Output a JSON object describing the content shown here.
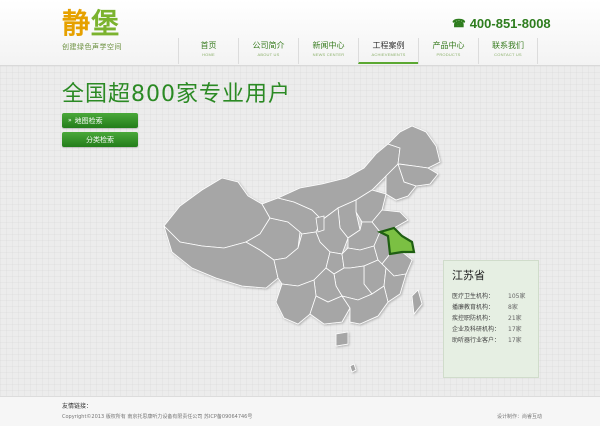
{
  "header": {
    "logo_title": "静堡",
    "logo_subtitle": "创建绿色声学空间",
    "phone": "400-851-8008"
  },
  "nav": [
    {
      "cn": "首页",
      "en": "HOME",
      "active": false
    },
    {
      "cn": "公司简介",
      "en": "ABOUT US",
      "active": false
    },
    {
      "cn": "新闻中心",
      "en": "NEWS CENTER",
      "active": false
    },
    {
      "cn": "工程案例",
      "en": "ACHIEVEMENTS",
      "active": true
    },
    {
      "cn": "产品中心",
      "en": "PRODUCTS",
      "active": false
    },
    {
      "cn": "联系我们",
      "en": "CONTACT US",
      "active": false
    }
  ],
  "main": {
    "headline": "全国超800家专业用户",
    "map_search_label": "地图检索",
    "category_search_label": "分类检索"
  },
  "map": {
    "highlighted_region": "江苏省",
    "highlight_color": "#7bc043",
    "base_color": "#a6a6a6"
  },
  "info": {
    "province": "江苏省",
    "rows": [
      {
        "label": "医疗卫生机构：",
        "value": "105家"
      },
      {
        "label": "播廉教育机构：",
        "value": "8家"
      },
      {
        "label": "疾控职防机构：",
        "value": "21家"
      },
      {
        "label": "企业及科研机构：",
        "value": "17家"
      },
      {
        "label": "助听器行业客户：",
        "value": "17家"
      }
    ]
  },
  "footer": {
    "links_label": "友情链接：",
    "copyright": "Copyright©2013  版权所有  南京托思康听力设备有限责任公司  苏ICP备09064746号",
    "design": "设计制作：尚睿互动"
  }
}
